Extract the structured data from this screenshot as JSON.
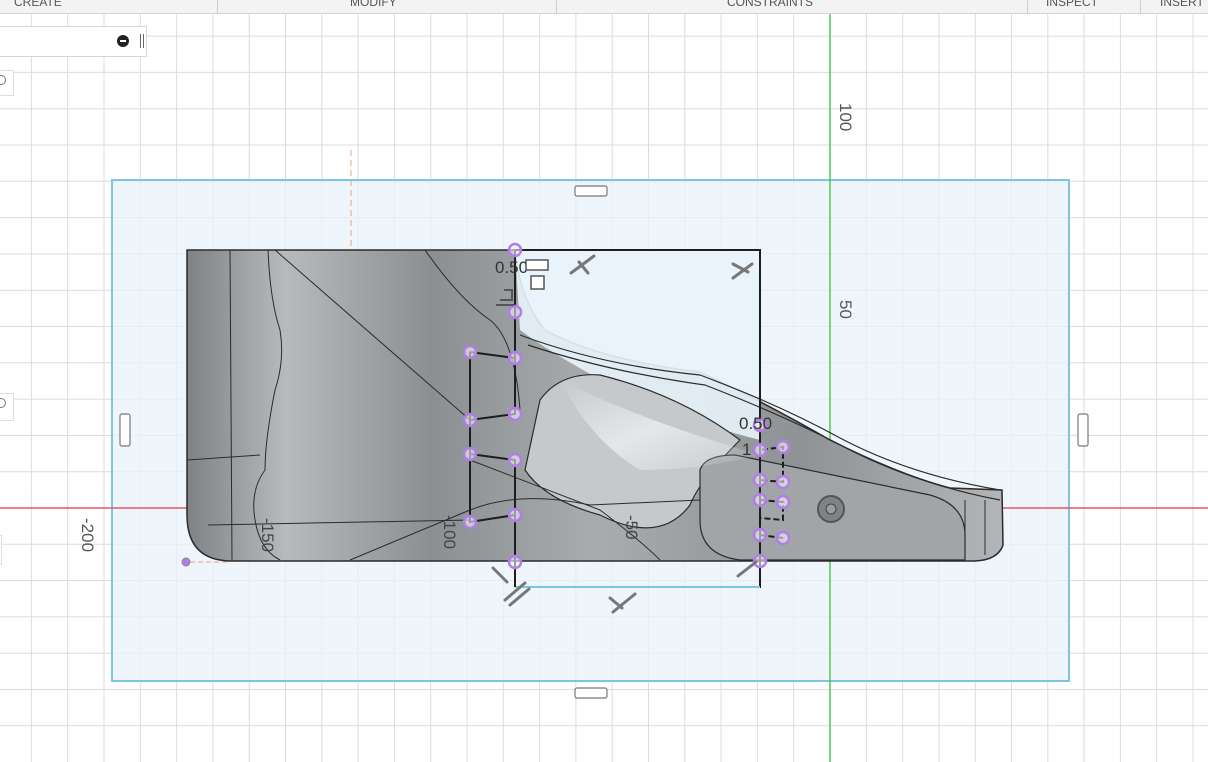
{
  "toolbar": {
    "tabs": [
      {
        "label": "CREATE"
      },
      {
        "label": "MODIFY"
      },
      {
        "label": "CONSTRAINTS"
      },
      {
        "label": "INSPECT"
      },
      {
        "label": "INSERT"
      }
    ]
  },
  "canvas": {
    "axis_labels": {
      "y_100": "100",
      "y_50": "50",
      "x_minus200": "-200",
      "x_minus150": "-150",
      "x_minus100": "-100",
      "x_minus50": "-50"
    },
    "dimension_labels": {
      "top_dim": "0.50",
      "right_dim": "0.50",
      "right_dim_prefix": "1"
    },
    "icons": {
      "panel_collapse": "minus-circle-icon",
      "panel_pin": "pin-icon",
      "constraint": "perpendicular-constraint-icon",
      "handle": "resize-handle-icon",
      "origin": "origin-icon"
    },
    "colors": {
      "grid": "#dcdcdc",
      "grid_major": "#c4c4c4",
      "x_axis": "#e05a5a",
      "y_axis": "#42c742",
      "selection_fill": "#e8f3fb",
      "selection_stroke": "#7ec4e6",
      "body_fill": "#8a8d90",
      "point": "#b07ee6"
    }
  }
}
